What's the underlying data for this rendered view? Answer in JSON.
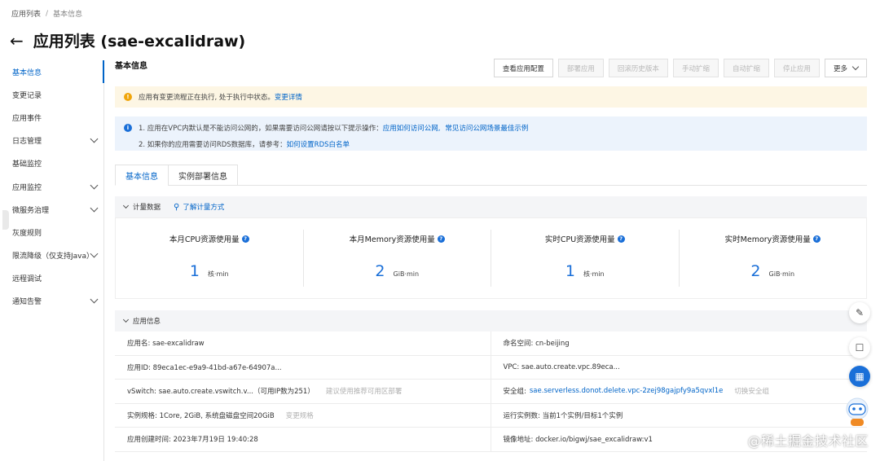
{
  "breadcrumb": {
    "parent": "应用列表",
    "separator": "/",
    "current": "基本信息"
  },
  "page_title": "应用列表 (sae-excalidraw)",
  "sidebar": {
    "items": [
      {
        "label": "基本信息",
        "active": true,
        "expandable": false
      },
      {
        "label": "变更记录",
        "active": false,
        "expandable": false
      },
      {
        "label": "应用事件",
        "active": false,
        "expandable": false
      },
      {
        "label": "日志管理",
        "active": false,
        "expandable": true
      },
      {
        "label": "基础监控",
        "active": false,
        "expandable": false
      },
      {
        "label": "应用监控",
        "active": false,
        "expandable": true
      },
      {
        "label": "微服务治理",
        "active": false,
        "expandable": true
      },
      {
        "label": "灰度规则",
        "active": false,
        "expandable": false
      },
      {
        "label": "限流降级（仅支持Java）",
        "active": false,
        "expandable": true
      },
      {
        "label": "远程调试",
        "active": false,
        "expandable": false
      },
      {
        "label": "通知告警",
        "active": false,
        "expandable": true
      }
    ]
  },
  "section_title": "基本信息",
  "toolbar": {
    "view_config": "查看应用配置",
    "deploy": "部署应用",
    "rollback": "回滚历史版本",
    "manual_scale": "手动扩缩",
    "auto_scale": "自动扩缩",
    "stop": "停止应用",
    "more": "更多"
  },
  "warning": {
    "text": "应用有变更流程正在执行, 处于执行中状态。",
    "link": "变更详情"
  },
  "info_notice": {
    "line1_text": "1. 应用在VPC内默认是不能访问公网的，如果需要访问公网请按以下提示操作：",
    "line1_link1": "应用如何访问公网,",
    "line1_link2": "常见访问公网场景最佳示例",
    "line2_text": "2. 如果你的应用需要访问RDS数据库，请参考：",
    "line2_link": "如何设置RDS白名单"
  },
  "tabs": [
    "基本信息",
    "实例部署信息"
  ],
  "metering": {
    "header": "计量数据",
    "link": "了解计量方式",
    "items": [
      {
        "label": "本月CPU资源使用量",
        "value": "1",
        "unit": "核·min"
      },
      {
        "label": "本月Memory资源使用量",
        "value": "2",
        "unit": "GiB·min"
      },
      {
        "label": "实时CPU资源使用量",
        "value": "1",
        "unit": "核·min"
      },
      {
        "label": "实时Memory资源使用量",
        "value": "2",
        "unit": "GiB·min"
      }
    ]
  },
  "app_info": {
    "header": "应用信息",
    "rows": [
      {
        "left": "应用名: sae-excalidraw",
        "right": "命名空间: cn-beijing"
      },
      {
        "left": "应用ID: 89eca1ec-e9a9-41bd-a67e-64907a...",
        "right": "VPC: sae.auto.create.vpc.89eca..."
      },
      {
        "left": "vSwitch: sae.auto.create.vswitch.v...（可用IP数为251）",
        "left_extra": "建议使用推荐可用区部署",
        "right_label": "安全组:",
        "right_link": "sae.serverless.donot.delete.vpc-2zej98gajpfy9a5qvxl1e",
        "right_extra": "切换安全组"
      },
      {
        "left": "实例规格: 1Core, 2GiB, 系统盘磁盘空间20GiB",
        "left_extra": "变更规格",
        "right": "运行实例数: 当前1个实例/目标1个实例"
      },
      {
        "left": "应用创建时间: 2023年7月19日 19:40:28",
        "right": "镜像地址: docker.io/bigwj/sae_excalidraw:v1"
      }
    ]
  },
  "watermark": "@稀土掘金技术社区"
}
